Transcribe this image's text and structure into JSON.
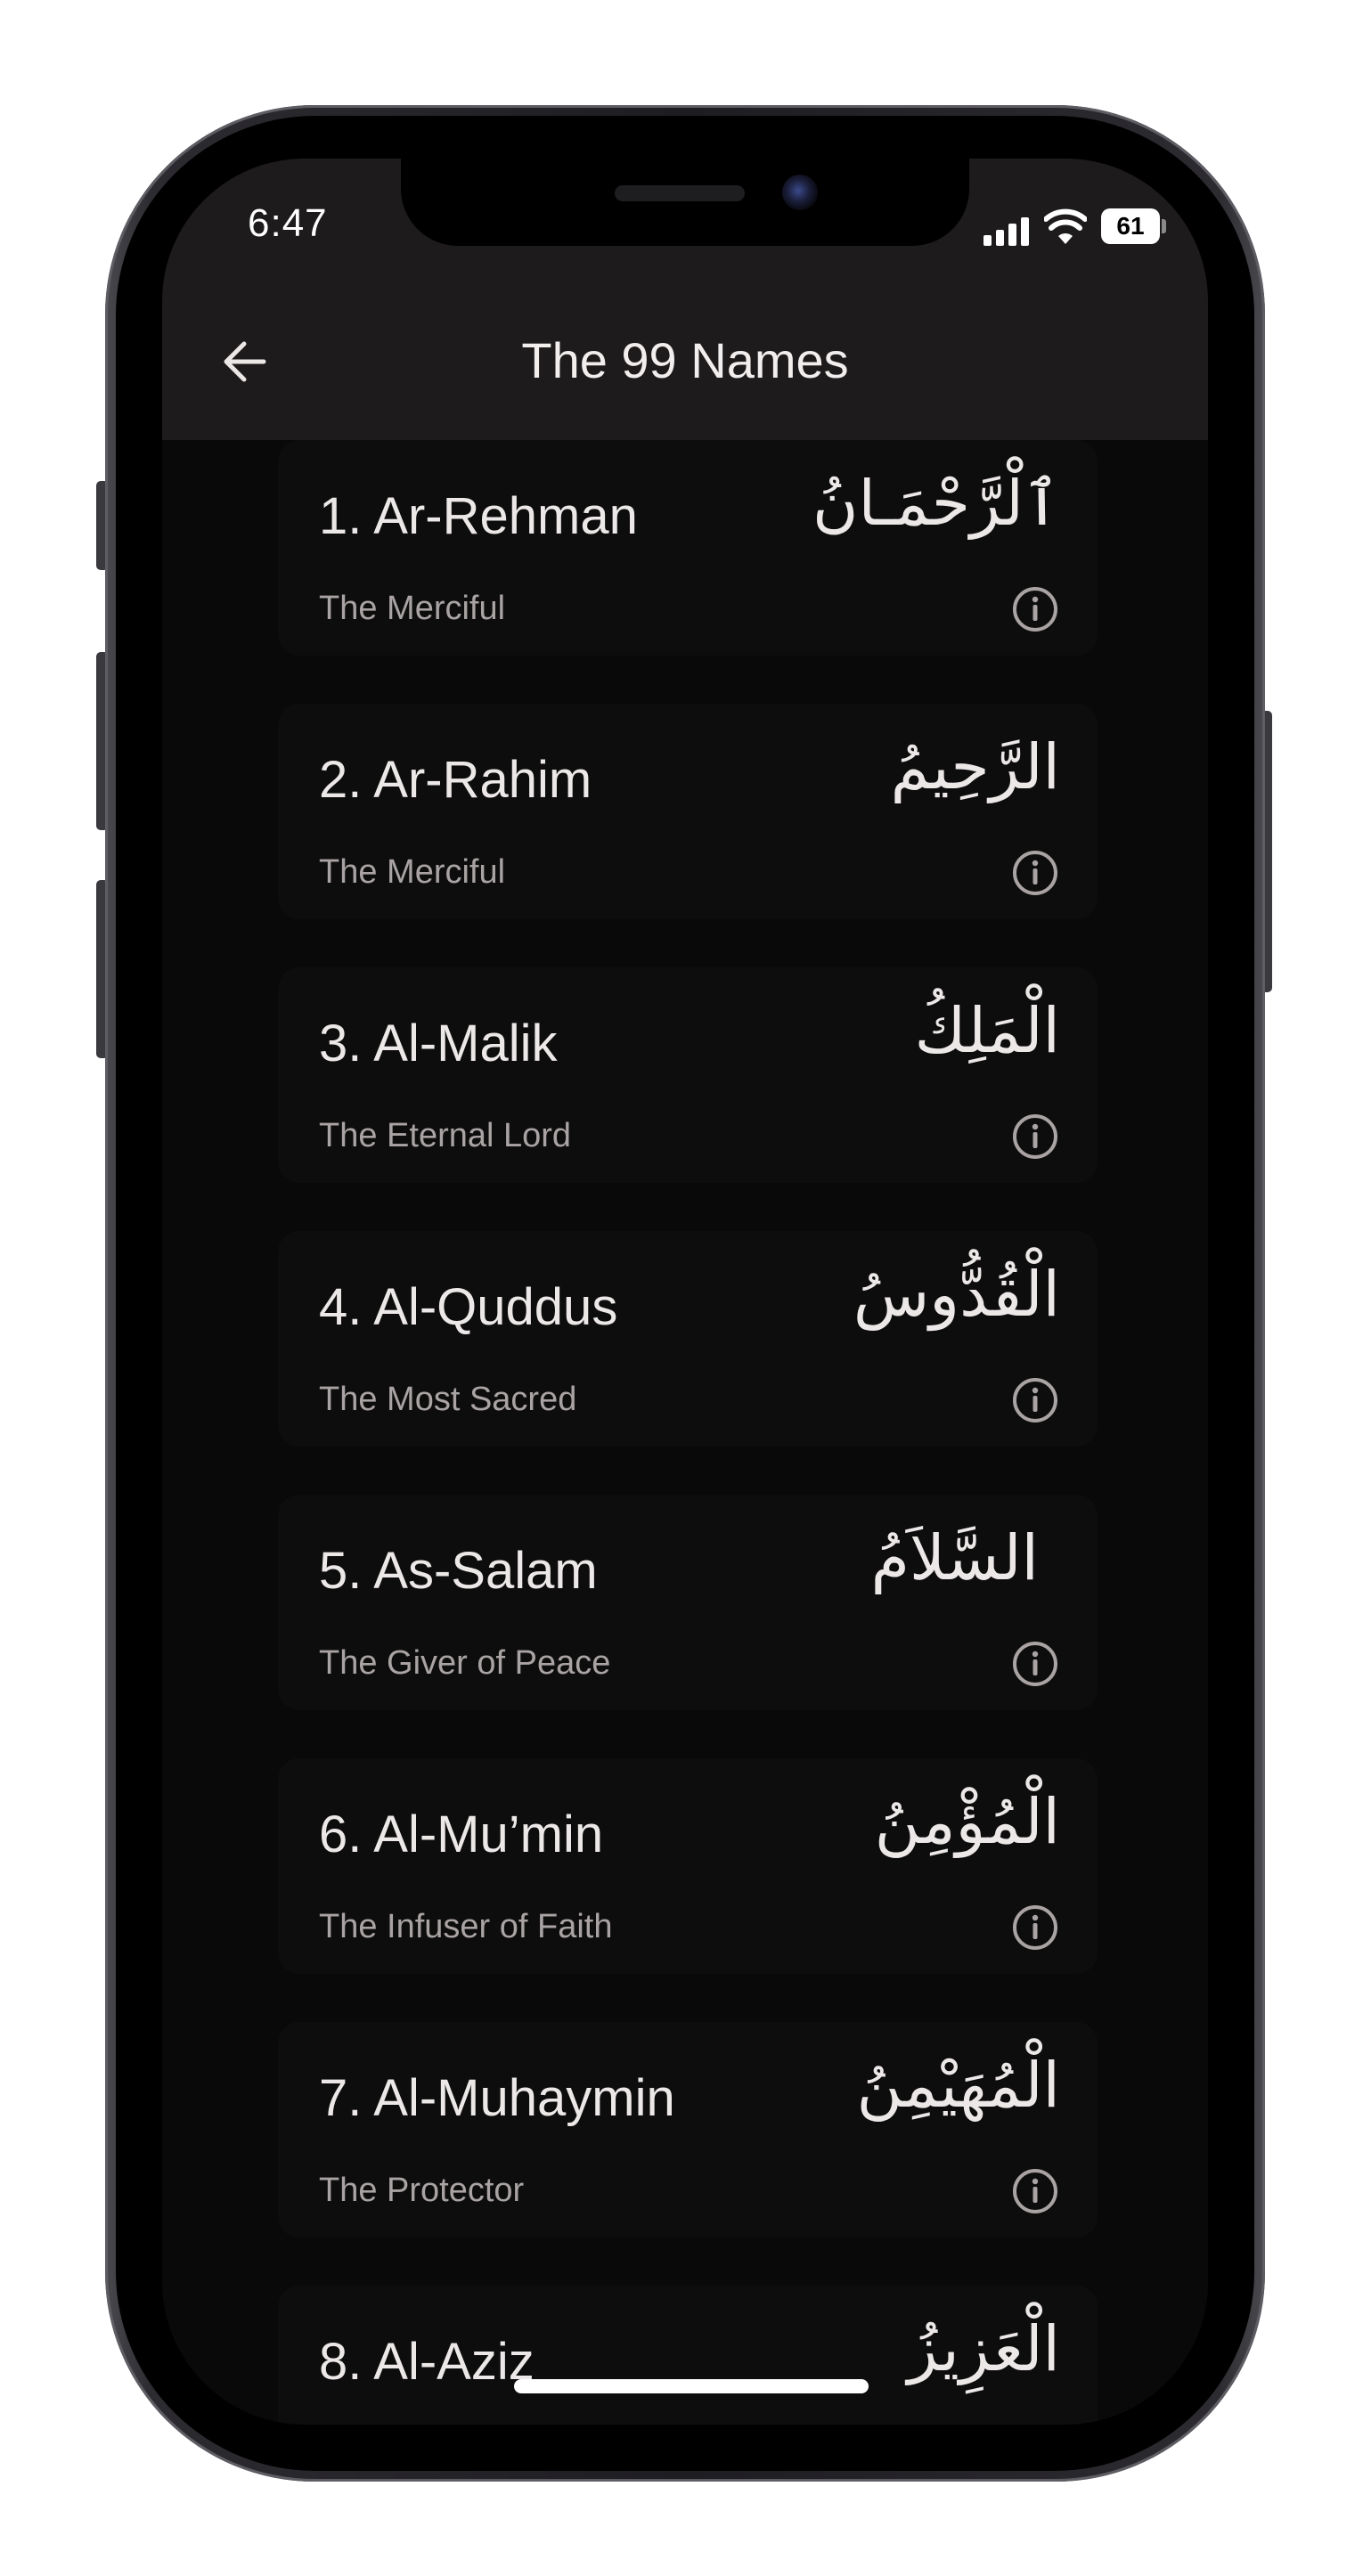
{
  "status_bar": {
    "time": "6:47",
    "battery": "61"
  },
  "header": {
    "title": "The 99 Names"
  },
  "names": [
    {
      "label": "1. Ar-Rehman",
      "arabic": "ٱلْرَّحْمَـانُ",
      "meaning": "The Merciful"
    },
    {
      "label": "2. Ar-Rahim",
      "arabic": "الرَّحِيمُ",
      "meaning": "The Merciful"
    },
    {
      "label": "3. Al-Malik",
      "arabic": "الْمَلِكُ",
      "meaning": "The Eternal Lord"
    },
    {
      "label": "4. Al-Quddus",
      "arabic": "الْقُدُّوسُ",
      "meaning": "The Most Sacred"
    },
    {
      "label": "5. As-Salam",
      "arabic": "السَّلاَمُ",
      "meaning": "The Giver of Peace"
    },
    {
      "label": "6. Al-Mu’min",
      "arabic": "الْمُؤْمِنُ",
      "meaning": "The Infuser of Faith"
    },
    {
      "label": "7. Al-Muhaymin",
      "arabic": "الْمُهَيْمِنُ",
      "meaning": "The Protector"
    },
    {
      "label": "8. Al-Aziz",
      "arabic": "الْعَزِيزُ",
      "meaning": ""
    }
  ]
}
